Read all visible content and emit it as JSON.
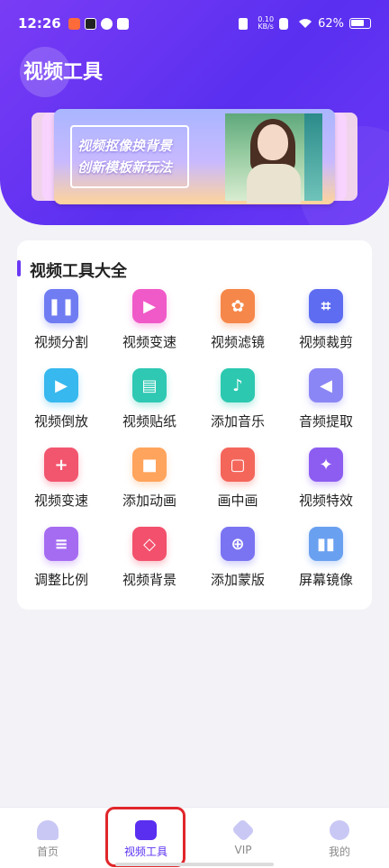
{
  "statusbar": {
    "time": "12:26",
    "net_top": "0.10",
    "net_bottom": "KB/s",
    "battery": "62%"
  },
  "header": {
    "title": "视频工具"
  },
  "banner": {
    "line1": "视频抠像换背景",
    "line2": "创新模板新玩法"
  },
  "tools_section": {
    "title": "视频工具大全",
    "items": [
      {
        "label": "视频分割",
        "icon": "split-icon",
        "color": "#6f7cf2"
      },
      {
        "label": "视频变速",
        "icon": "camera-speed-icon",
        "color": "#f05ac8"
      },
      {
        "label": "视频滤镜",
        "icon": "flower-filter-icon",
        "color": "#f6874a"
      },
      {
        "label": "视频裁剪",
        "icon": "crop-icon",
        "color": "#5d6cf0"
      },
      {
        "label": "视频倒放",
        "icon": "tv-reverse-icon",
        "color": "#37b8ee"
      },
      {
        "label": "视频贴纸",
        "icon": "sticker-icon",
        "color": "#2fc8b3"
      },
      {
        "label": "添加音乐",
        "icon": "music-note-icon",
        "color": "#2cc8b0"
      },
      {
        "label": "音频提取",
        "icon": "speaker-icon",
        "color": "#8b86f5"
      },
      {
        "label": "视频变速",
        "icon": "add-file-icon",
        "color": "#f2556e"
      },
      {
        "label": "添加动画",
        "icon": "animation-icon",
        "color": "#ffa45c"
      },
      {
        "label": "画中画",
        "icon": "picture-in-picture-icon",
        "color": "#f4655a"
      },
      {
        "label": "视频特效",
        "icon": "stars-effect-icon",
        "color": "#8c5df0"
      },
      {
        "label": "调整比例",
        "icon": "list-ratio-icon",
        "color": "#a56cf2"
      },
      {
        "label": "视频背景",
        "icon": "hexagon-background-icon",
        "color": "#f2506c"
      },
      {
        "label": "添加蒙版",
        "icon": "plus-circle-icon",
        "color": "#7a74f2"
      },
      {
        "label": "屏幕镜像",
        "icon": "mirror-icon",
        "color": "#6aa0f0"
      }
    ]
  },
  "nav": {
    "items": [
      {
        "label": "首页",
        "icon": "home-icon"
      },
      {
        "label": "视频工具",
        "icon": "video-camera-icon"
      },
      {
        "label": "VIP",
        "icon": "vip-diamond-icon"
      },
      {
        "label": "我的",
        "icon": "profile-icon"
      }
    ],
    "active_index": 1
  },
  "colors": {
    "accent": "#5a2ff0",
    "highlight": "#e0262b"
  }
}
